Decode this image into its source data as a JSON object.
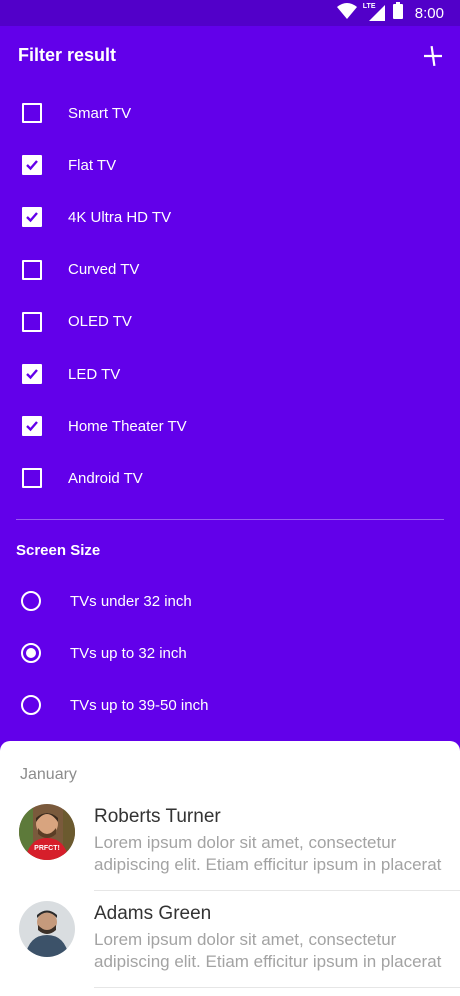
{
  "status_bar": {
    "time": "8:00",
    "network": "LTE",
    "icons": [
      "wifi-icon",
      "lte-signal-icon",
      "battery-icon"
    ]
  },
  "header": {
    "title": "Filter result",
    "action_icon": "add-icon"
  },
  "filters": [
    {
      "label": "Smart TV",
      "checked": false
    },
    {
      "label": "Flat TV",
      "checked": true
    },
    {
      "label": "4K Ultra HD TV",
      "checked": true
    },
    {
      "label": "Curved TV",
      "checked": false
    },
    {
      "label": "OLED TV",
      "checked": false
    },
    {
      "label": "LED TV",
      "checked": true
    },
    {
      "label": "Home Theater TV",
      "checked": true
    },
    {
      "label": "Android TV",
      "checked": false
    }
  ],
  "screen_size": {
    "title": "Screen Size",
    "options": [
      {
        "label": "TVs under 32 inch",
        "selected": false
      },
      {
        "label": "TVs up to 32 inch",
        "selected": true
      },
      {
        "label": "TVs up to 39-50 inch",
        "selected": false
      }
    ]
  },
  "sheet": {
    "header": "January",
    "items": [
      {
        "name": "Roberts Turner",
        "line1": "Lorem ipsum dolor sit amet, consectetur",
        "line2": "adipiscing elit. Etiam efficitur ipsum in placerat",
        "avatar_badge": "PRFCT!"
      },
      {
        "name": "Adams Green",
        "line1": "Lorem ipsum dolor sit amet, consectetur",
        "line2": "adipiscing elit. Etiam efficitur ipsum in placerat"
      }
    ]
  },
  "colors": {
    "primary": "#6200EA",
    "status_bar": "#5200C9",
    "sheet_bg": "#FFFFFF",
    "secondary_text": "#A3A3A3"
  }
}
